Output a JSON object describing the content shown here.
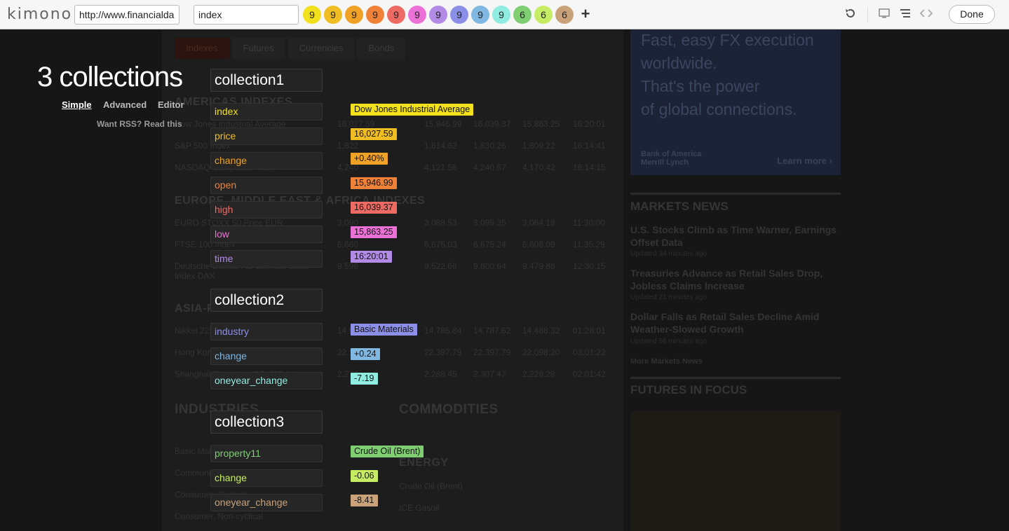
{
  "toolbar": {
    "logo": "kimono",
    "url_value": "http://www.financialda",
    "field_value": "index",
    "circles": [
      {
        "label": "9",
        "color": "#f2e01c"
      },
      {
        "label": "9",
        "color": "#f0bd22"
      },
      {
        "label": "9",
        "color": "#f0a226"
      },
      {
        "label": "9",
        "color": "#ef8236"
      },
      {
        "label": "9",
        "color": "#ee6b63"
      },
      {
        "label": "9",
        "color": "#ec71d6"
      },
      {
        "label": "9",
        "color": "#b28be6"
      },
      {
        "label": "9",
        "color": "#8c8fe8"
      },
      {
        "label": "9",
        "color": "#80b8e2"
      },
      {
        "label": "9",
        "color": "#90ece0"
      },
      {
        "label": "6",
        "color": "#7fcf72"
      },
      {
        "label": "6",
        "color": "#c6ec64"
      },
      {
        "label": "6",
        "color": "#c9a27a"
      }
    ],
    "add_label": "+",
    "done_label": "Done",
    "icons": [
      "undo-icon",
      "monitor-icon",
      "list-icon",
      "code-icon"
    ]
  },
  "panel": {
    "title": "3 collections",
    "modes": [
      {
        "label": "Simple",
        "active": true
      },
      {
        "label": "Advanced",
        "active": false
      },
      {
        "label": "Editor",
        "active": false
      }
    ],
    "rss": "Want RSS? Read this"
  },
  "collections": [
    {
      "name": "collection1",
      "properties": [
        {
          "name": "index",
          "value": "Dow Jones Industrial Average",
          "color": "#f2e01c"
        },
        {
          "name": "price",
          "value": "16,027.59",
          "color": "#f0bd22"
        },
        {
          "name": "change",
          "value": "+0.40%",
          "color": "#f0a226"
        },
        {
          "name": "open",
          "value": "15,946.99",
          "color": "#ef8236"
        },
        {
          "name": "high",
          "value": "16,039.37",
          "color": "#ee6b63"
        },
        {
          "name": "low",
          "value": "15,863.25",
          "color": "#ec71d6"
        },
        {
          "name": "time",
          "value": "16:20:01",
          "color": "#b28be6"
        }
      ]
    },
    {
      "name": "collection2",
      "properties": [
        {
          "name": "industry",
          "value": "Basic Materials",
          "color": "#8c8fe8"
        },
        {
          "name": "change",
          "value": "+0.24",
          "color": "#80b8e2"
        },
        {
          "name": "oneyear_change",
          "value": "-7.19",
          "color": "#90ece0"
        }
      ]
    },
    {
      "name": "collection3",
      "properties": [
        {
          "name": "property11",
          "value": "Crude Oil (Brent)",
          "color": "#7fcf72"
        },
        {
          "name": "change",
          "value": "-0.06",
          "color": "#c6ec64"
        },
        {
          "name": "oneyear_change",
          "value": "-8.41",
          "color": "#c9a27a"
        }
      ]
    }
  ],
  "site": {
    "tabs": [
      "Indexes",
      "Futures",
      "Currencies",
      "Bonds"
    ],
    "headings": [
      "AMERICAS INDEXES",
      "EUROPE, MIDDLE EAST & AFRICA INDEXES",
      "ASIA-PACIFIC INDEXES",
      "INDUSTRIES",
      "COMMODITIES",
      "ENERGY"
    ],
    "rows": [
      [
        "Dow Jones Industrial Average",
        "16,027.59",
        "15,946.99",
        "16,039.37",
        "15,863.25",
        "16:20:01"
      ],
      [
        "S&P 500 Index",
        "1,822",
        "1,814.62",
        "1,830.26",
        "1,809.22",
        "16:14:41"
      ],
      [
        "NASDAQ Composite Index",
        "4,240",
        "4,121.56",
        "4,240.67",
        "4,170.42",
        "16:14:15"
      ],
      [
        "EURO STOXX 50 Price EUR",
        "3,090",
        "3,088.53",
        "3,099.35",
        "3,064.18",
        "11:30:00"
      ],
      [
        "FTSE 100 Index",
        "6,660",
        "6,675.03",
        "6,675.24",
        "6,608.09",
        "11:35:29"
      ],
      [
        "Deutsche Boerse AG German Stock Index DAX",
        "9,596",
        "9,522.66",
        "9,600.64",
        "9,479.86",
        "12:30:15"
      ],
      [
        "Nikkei 225",
        "14,534",
        "14,785.84",
        "14,787.62",
        "14,488.32",
        "01:28:01"
      ],
      [
        "Hong Kong Hang Seng Index",
        "22,166",
        "22,397.79",
        "22,397.79",
        "22,098.20",
        "03:01:22"
      ],
      [
        "Shanghai Shenzhen CSI 300 Index",
        "2,276",
        "2,288.45",
        "2,307.47",
        "2,228.28",
        "02:01:42"
      ],
      [
        "Basic Materials",
        "",
        "",
        "",
        "",
        ""
      ],
      [
        "Communications",
        "",
        "",
        "",
        "",
        ""
      ],
      [
        "Consumer, Cyclical",
        "",
        "",
        "",
        "",
        ""
      ],
      [
        "Consumer, Non-cyclical",
        "",
        "",
        "",
        "",
        ""
      ]
    ],
    "commodity_rows": [
      "Crude Oil (Brent)",
      "ICE Gasoil"
    ],
    "ad_lines": [
      "Fast, easy FX execution",
      "worldwide.",
      "That's the power",
      "of global connections."
    ],
    "ad_brand": "Bank of America Merrill Lynch",
    "ad_learn": "Learn more ›",
    "markets_title": "MARKETS NEWS",
    "news": [
      {
        "headline": "U.S. Stocks Climb as Time Warner, Earnings Offset Data",
        "time": "Updated 34 minutes ago"
      },
      {
        "headline": "Treasuries Advance as Retail Sales Drop, Jobless Claims Increase",
        "time": "Updated 21 minutes ago"
      },
      {
        "headline": "Dollar Falls as Retail Sales Decline Amid Weather-Slowed Growth",
        "time": "Updated 58 minutes ago"
      }
    ],
    "more_news": "More Markets News",
    "futures_title": "FUTURES IN FOCUS"
  }
}
